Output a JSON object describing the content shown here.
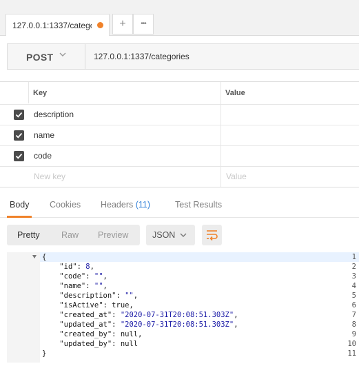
{
  "tab": {
    "title": "127.0.0.1:1337/categc",
    "add_icon": "+",
    "more_icon": "•••",
    "unsaved_color": "#f0822a"
  },
  "request": {
    "method": "POST",
    "url": "127.0.0.1:1337/categories"
  },
  "params": {
    "headers": {
      "key": "Key",
      "value": "Value"
    },
    "rows": [
      {
        "key": "description",
        "checked": true
      },
      {
        "key": "name",
        "checked": true
      },
      {
        "key": "code",
        "checked": true
      }
    ],
    "new_key_placeholder": "New key",
    "new_value_placeholder": "Value"
  },
  "response_tabs": {
    "body": "Body",
    "cookies": "Cookies",
    "headers": "Headers",
    "headers_count": "(11)",
    "test_results": "Test Results"
  },
  "view": {
    "pretty": "Pretty",
    "raw": "Raw",
    "preview": "Preview",
    "format": "JSON"
  },
  "code": {
    "line_numbers": [
      "1",
      "2",
      "3",
      "4",
      "5",
      "6",
      "7",
      "8",
      "9",
      "10",
      "11"
    ],
    "lines": [
      "{",
      "    \"id\": 8,",
      "    \"code\": \"\",",
      "    \"name\": \"\",",
      "    \"description\": \"\",",
      "    \"isActive\": true,",
      "    \"created_at\": \"2020-07-31T20:08:51.303Z\",",
      "    \"updated_at\": \"2020-07-31T20:08:51.303Z\",",
      "    \"created_by\": null,",
      "    \"updated_by\": null",
      "}"
    ]
  }
}
